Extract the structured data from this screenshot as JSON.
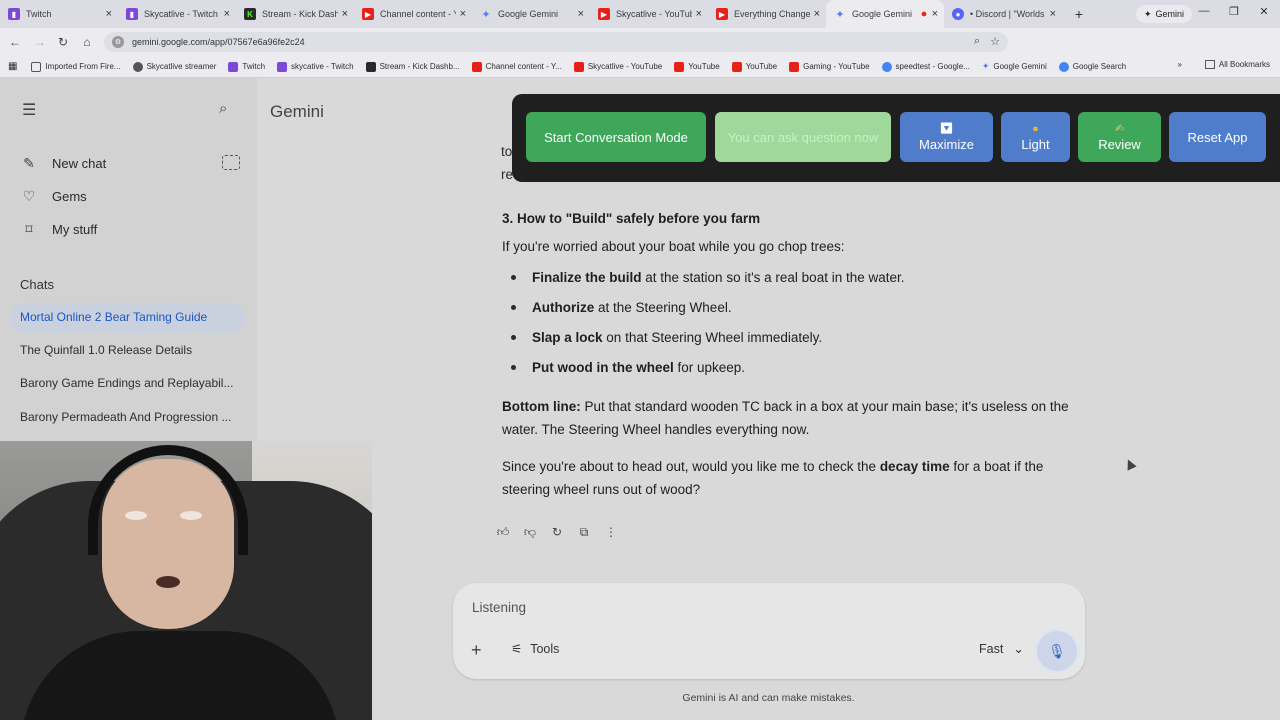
{
  "browser": {
    "tabs": [
      {
        "label": "Twitch",
        "icon": "twitch-icon"
      },
      {
        "label": "Skycatlive - Twitch",
        "icon": "twitch-icon"
      },
      {
        "label": "Stream - Kick Dashb",
        "icon": "kick-icon"
      },
      {
        "label": "Channel content - Y",
        "icon": "youtube-icon"
      },
      {
        "label": "Google Gemini",
        "icon": "gemini-icon"
      },
      {
        "label": "Skycatlive - YouTub",
        "icon": "youtube-icon"
      },
      {
        "label": "Everything Change",
        "icon": "youtube-icon"
      },
      {
        "label": "Google Gemini",
        "icon": "gemini-icon",
        "active": true,
        "recording": true
      },
      {
        "label": "• Discord | \"Worlds",
        "icon": "discord-icon"
      }
    ],
    "profile_tab": "Gemini",
    "url": "gemini.google.com/app/07567e6a96fe2c24",
    "bookmarks": [
      {
        "label": "Imported From Fire...",
        "icon": "folder-icon"
      },
      {
        "label": "Skycatlive streamer",
        "icon": "skycat-icon"
      },
      {
        "label": "Twitch",
        "icon": "twitch-icon"
      },
      {
        "label": "skycative - Twitch",
        "icon": "twitch-icon"
      },
      {
        "label": "Stream - Kick Dashb...",
        "icon": "kick-icon"
      },
      {
        "label": "Channel content - Y...",
        "icon": "youtube-icon"
      },
      {
        "label": "Skycatlive - YouTube",
        "icon": "youtube-icon"
      },
      {
        "label": "YouTube",
        "icon": "youtube-icon"
      },
      {
        "label": "YouTube",
        "icon": "youtube-icon"
      },
      {
        "label": "Gaming - YouTube",
        "icon": "youtube-icon"
      },
      {
        "label": "speedtest - Google...",
        "icon": "google-icon"
      },
      {
        "label": "Google Gemini",
        "icon": "gemini-icon"
      },
      {
        "label": "Google Search",
        "icon": "google-icon"
      }
    ],
    "all_bookmarks": "All Bookmarks"
  },
  "sidebar": {
    "new_chat": "New chat",
    "gems": "Gems",
    "my_stuff": "My stuff",
    "chats_heading": "Chats",
    "chats": [
      "Mortal Online 2 Bear Taming Guide",
      "The Quinfall 1.0 Release Details",
      "Barony Game Endings and Replayabil...",
      "Barony Permadeath And Progression ..."
    ]
  },
  "main": {
    "title": "Gemini",
    "cut_line1": "to",
    "cut_line2": "re",
    "section_heading": "3. How to \"Build\" safely before you farm",
    "intro": "If you're worried about your boat while you go chop trees:",
    "bullets": [
      {
        "bold": "Finalize the build",
        "rest": " at the station so it's a real boat in the water."
      },
      {
        "bold": "Authorize",
        "rest": " at the Steering Wheel."
      },
      {
        "bold": "Slap a lock",
        "rest": " on that Steering Wheel immediately."
      },
      {
        "bold": "Put wood in the wheel",
        "rest": " for upkeep."
      }
    ],
    "bottom_bold": "Bottom line:",
    "bottom_rest": " Put that standard wooden TC back in a box at your main base; it's useless on the water. The Steering Wheel handles everything now.",
    "followup_pre": "Since you're about to head out, would you like me to check the ",
    "followup_bold": "decay time",
    "followup_post": " for a boat if the steering wheel runs out of wood?",
    "input_placeholder": "Listening",
    "tools_label": "Tools",
    "mode_label": "Fast",
    "disclaimer": "Gemini is AI and can make mistakes."
  },
  "overlay": {
    "start_label": "Start Conversation Mode",
    "ask_label": "You can ask question now",
    "maximize_label": "Maximize",
    "light_label": "Light",
    "review_label": "Review",
    "reset_label": "Reset App"
  }
}
